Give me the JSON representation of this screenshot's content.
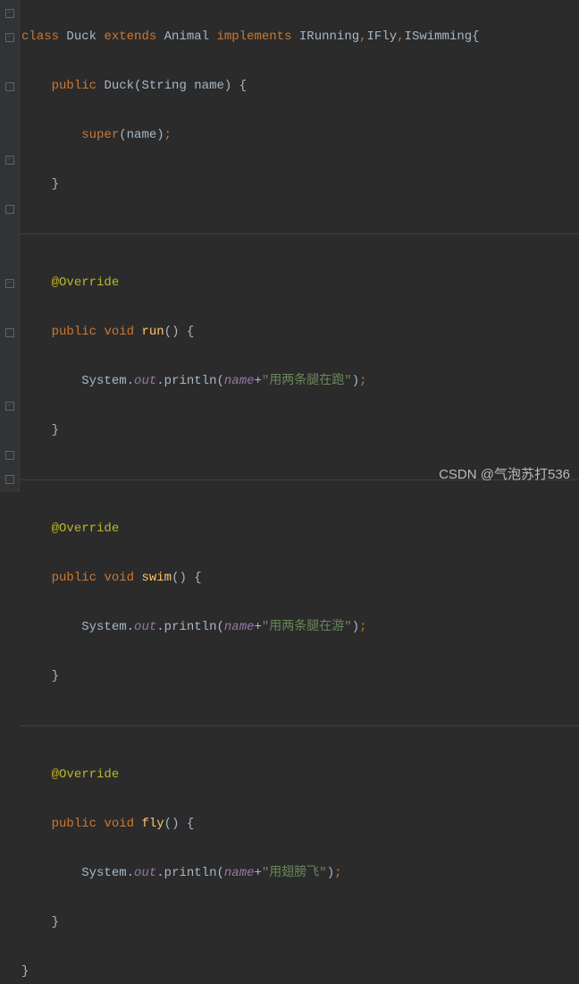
{
  "code": {
    "class_kw": "class",
    "class_name": "Duck",
    "extends_kw": "extends",
    "parent": "Animal",
    "implements_kw": "implements",
    "iface1": "IRunning",
    "iface2": "IFly",
    "iface3": "ISwimming",
    "public_kw": "public",
    "void_kw": "void",
    "ctor_name": "Duck",
    "ctor_param_type": "String",
    "ctor_param_name": "name",
    "super_kw": "super",
    "super_arg": "name",
    "override": "@Override",
    "method_run": "run",
    "method_swim": "swim",
    "method_fly": "fly",
    "system": "System",
    "out": "out",
    "println": "println",
    "name_field": "name",
    "str_run": "\"用两条腿在跑\"",
    "str_swim": "\"用两条腿在游\"",
    "str_fly": "\"用翅膀飞\"",
    "close_brace": "}",
    "open_brace": "{",
    "dot": ".",
    "lparen": "(",
    "rparen": ")",
    "semi": ";",
    "comma": ",",
    "plus": "+",
    "space": " "
  },
  "watermark": "CSDN @气泡苏打536"
}
